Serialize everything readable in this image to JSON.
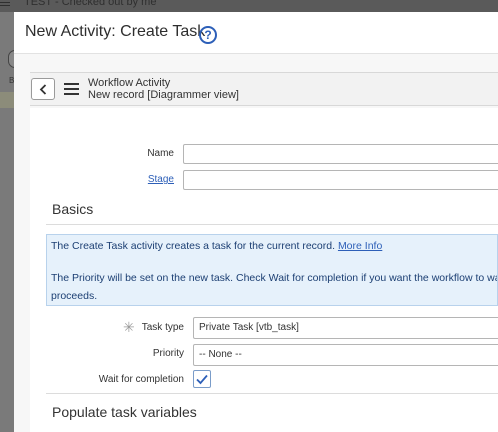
{
  "background": {
    "app_title": "TEST - Checked out by me"
  },
  "modal": {
    "title": "New Activity: Create Task",
    "help": "?"
  },
  "form_header": {
    "title_line1": "Workflow Activity",
    "title_line2": "New record [Diagrammer view]"
  },
  "fields": {
    "name_label": "Name",
    "name_value": "",
    "stage_label": "Stage",
    "stage_value": ""
  },
  "basics": {
    "section_title": "Basics",
    "info_line1": "The Create Task activity creates a task for the current record.",
    "info_link": "More Info",
    "info_line2": "The Priority will be set on the new task. Check Wait for completion if you want the workflow to wait until the task completes before it",
    "info_line3": "proceeds.",
    "task_type_label": "Task type",
    "task_type_value": "Private Task [vtb_task]",
    "priority_label": "Priority",
    "priority_value": "-- None --",
    "wait_label": "Wait for completion",
    "wait_checked": true
  },
  "populate": {
    "section_title": "Populate task variables"
  },
  "colors": {
    "link": "#2d5fb8",
    "info_bg": "#e6f1fb",
    "info_text": "#1c3f73"
  }
}
